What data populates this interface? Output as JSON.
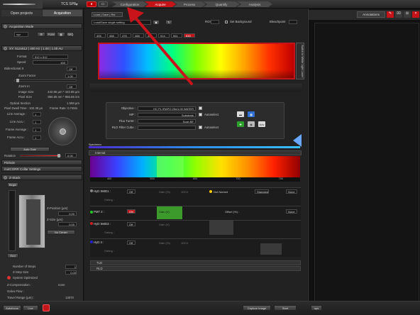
{
  "topbar": {
    "system_name": "TCS SP8",
    "tabs": [
      "Configuration",
      "Acquire",
      "Process",
      "Quantify",
      "Analysis"
    ],
    "active_tab": "Acquire",
    "annotations_label": "Annotations"
  },
  "left": {
    "tabs": [
      "Open projects",
      "Acquisition"
    ],
    "acq_mode": {
      "title": "Acquisition Mode",
      "value": "xyz",
      "flim_label": "FLIM",
      "extra_label": "SEQ"
    },
    "xy_panel": {
      "title": "XY: 512x512 | 400 Hz | 1.00 | 1.00 AU",
      "format_label": "Format",
      "format_value": "512 x 512",
      "speed_label": "Speed",
      "speed_value": "400",
      "bidir_label": "Bidirectional X",
      "bidir_value": "Off",
      "zoom_factor_label": "Zoom Factor",
      "zoom_factor_value": "1.00",
      "zoom_in_label": "Zoom In",
      "zoom_in_value": "Off",
      "image_size_label": "Image Size",
      "image_size_value": "442.86 µm * 442.86 µm",
      "pixel_size_label": "Pixel Size",
      "pixel_size_value": "866.65 nm * 866.65 nm",
      "optical_section_label": "Optical Section",
      "optical_section_value": "1.559 µm",
      "dwell_label": "Pixel Dwell Time : 102.38 µs",
      "frame_rate_label": "Frame Rate: 0.745/s",
      "line_avg_label": "Line Average :",
      "line_avg_value": "1",
      "line_accu_label": "Line Accu :",
      "line_accu_value": "1",
      "frame_avg_label": "Frame Average :",
      "frame_avg_value": "1",
      "frame_accu_label": "Frame Accu :",
      "frame_accu_value": "1",
      "auto_gain_label": "Auto Gain",
      "rotation_label": "Rotation",
      "rotation_value": "0.00",
      "pinhole_label": "Pinhole",
      "collar_label": "motCORR Collar Settings"
    },
    "zstack": {
      "title": "Z-Stack",
      "begin_label": "Begin",
      "end_label": "End",
      "zpos_label": "Z-Position (µm)",
      "zpos_value": "0.00",
      "zsize_label": "Z-Size (µm)",
      "zsize_value": "0.00",
      "nocenter_label": "No Center",
      "steps_label": "Number of Steps",
      "steps_value": "1",
      "stepsize_label": "Z-Step Size",
      "stepsize_value": "0.00",
      "sysopt_label": "System Optimized",
      "zcomp_label": "Z-Compensation :",
      "zcomp_value": "none",
      "galvo_label": "Galvo Flow :",
      "travel_label": "Travel Range (µm) :",
      "travel_value": "13070"
    }
  },
  "center": {
    "load_save": "Load | Save | Rst",
    "setting_label": "Load/Save single setting",
    "roi_label": "ROI",
    "set_bg_label": "Set Background",
    "bleachpoint_label": "Bleachpoint",
    "laser_lines": [
      "405",
      "458",
      "476",
      "488",
      "496",
      "514",
      "561",
      "633"
    ],
    "wll_label": "Switch to White Light Laser",
    "objective_label": "Objective :",
    "objective_value": "HC PL IRAPO  25x/1.00 WATER",
    "mp_label": "MP :",
    "mp_value": "Substrate",
    "turret_label": "Fluo Turret :",
    "turret_value": "Scan BF",
    "rld_label": "RLD Filter Cube :",
    "autoselect_label": "Autoselect",
    "specimen_label": "Specimen",
    "internal_label": "Internal",
    "spectrum_ticks": [
      "400",
      "500",
      "600",
      "700",
      "750"
    ],
    "channels": [
      {
        "name": "HyD SMD1 :",
        "state": "Off",
        "gain": "Gain (%)",
        "gain_value": "100.0",
        "offset_label": "",
        "dye": "Not Named",
        "mode": "Standard",
        "lut": "None",
        "color": "#999"
      },
      {
        "name": "PMT 2 :",
        "state": "ON",
        "gain": "Gain (V)",
        "gain_value": "",
        "offset_label": "Offset (%) :",
        "dye": "Not Named",
        "mode": "Standard",
        "lut": "None",
        "color": "#2c2"
      },
      {
        "name": "HyD SMD3 :",
        "state": "Off",
        "gain": "Gain (V)",
        "gain_value": "",
        "offset_label": "",
        "dye": "",
        "mode": "",
        "lut": "",
        "color": "#c22"
      },
      {
        "name": "HyD 4 :",
        "state": "Off",
        "gain": "Gain (%)",
        "gain_value": "100.0",
        "offset_label": "",
        "dye": "",
        "mode": "",
        "lut": "",
        "color": "#22c"
      }
    ],
    "gating_label": "Gating :",
    "tld_label": "TLD",
    "rld2_label": "RLD"
  },
  "bottom": {
    "autofocus_label": "Autofocus",
    "live_label": "Live",
    "capture_label": "Capture Image",
    "start_label": "Start",
    "ops_label": "ops"
  },
  "colors": {
    "accent": "#c4141a",
    "bg": "#1b1b1b",
    "panel": "#2a2a2a"
  }
}
